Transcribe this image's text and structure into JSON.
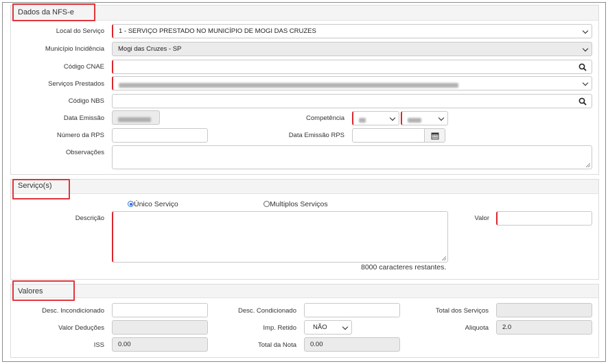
{
  "sections": {
    "nfse": "Dados da NFS-e",
    "servicos": "Serviço(s)",
    "valores": "Valores"
  },
  "nfse": {
    "local_label": "Local do Serviço",
    "local_value": "1 - SERVIÇO PRESTADO NO MUNICÍPIO DE MOGI DAS CRUZES",
    "municipio_label": "Município Incidência",
    "municipio_value": "Mogi das Cruzes - SP",
    "cnae_label": "Código CNAE",
    "cnae_value": "",
    "servicos_label": "Serviços Prestados",
    "nbs_label": "Código NBS",
    "nbs_value": "",
    "data_emissao_label": "Data Emissão",
    "competencia_label": "Competência",
    "numero_rps_label": "Número da RPS",
    "numero_rps_value": "",
    "data_emissao_rps_label": "Data Emissão RPS",
    "data_emissao_rps_value": "",
    "observacoes_label": "Observações",
    "observacoes_value": ""
  },
  "servico": {
    "unico_label": "Único Serviço",
    "unico_selected": true,
    "multiplos_label": "Multiplos Serviços",
    "descricao_label": "Descrição",
    "descricao_value": "",
    "valor_label": "Valor",
    "valor_value": "",
    "chars_remaining": "8000 caracteres restantes."
  },
  "valores": {
    "desc_incond_label": "Desc. Incondicionado",
    "desc_incond_value": "",
    "desc_cond_label": "Desc. Condicionado",
    "desc_cond_value": "",
    "total_servicos_label": "Total dos Serviços",
    "total_servicos_value": "",
    "valor_deducoes_label": "Valor Deduções",
    "valor_deducoes_value": "",
    "imp_retido_label": "Imp. Retido",
    "imp_retido_value": "NÃO",
    "aliquota_label": "Aliquota",
    "aliquota_value": "2.0",
    "iss_label": "ISS",
    "iss_value": "0.00",
    "total_nota_label": "Total da Nota",
    "total_nota_value": "0.00"
  },
  "icons": [
    "search-icon",
    "calendar-icon",
    "chevron-down-icon"
  ],
  "colors": {
    "required_border": "#d9262c",
    "highlight_box": "#e0353b",
    "radio_accent": "#2a6de0",
    "panel_header_bg": "#f4f4f4",
    "disabled_bg": "#ebebeb"
  }
}
